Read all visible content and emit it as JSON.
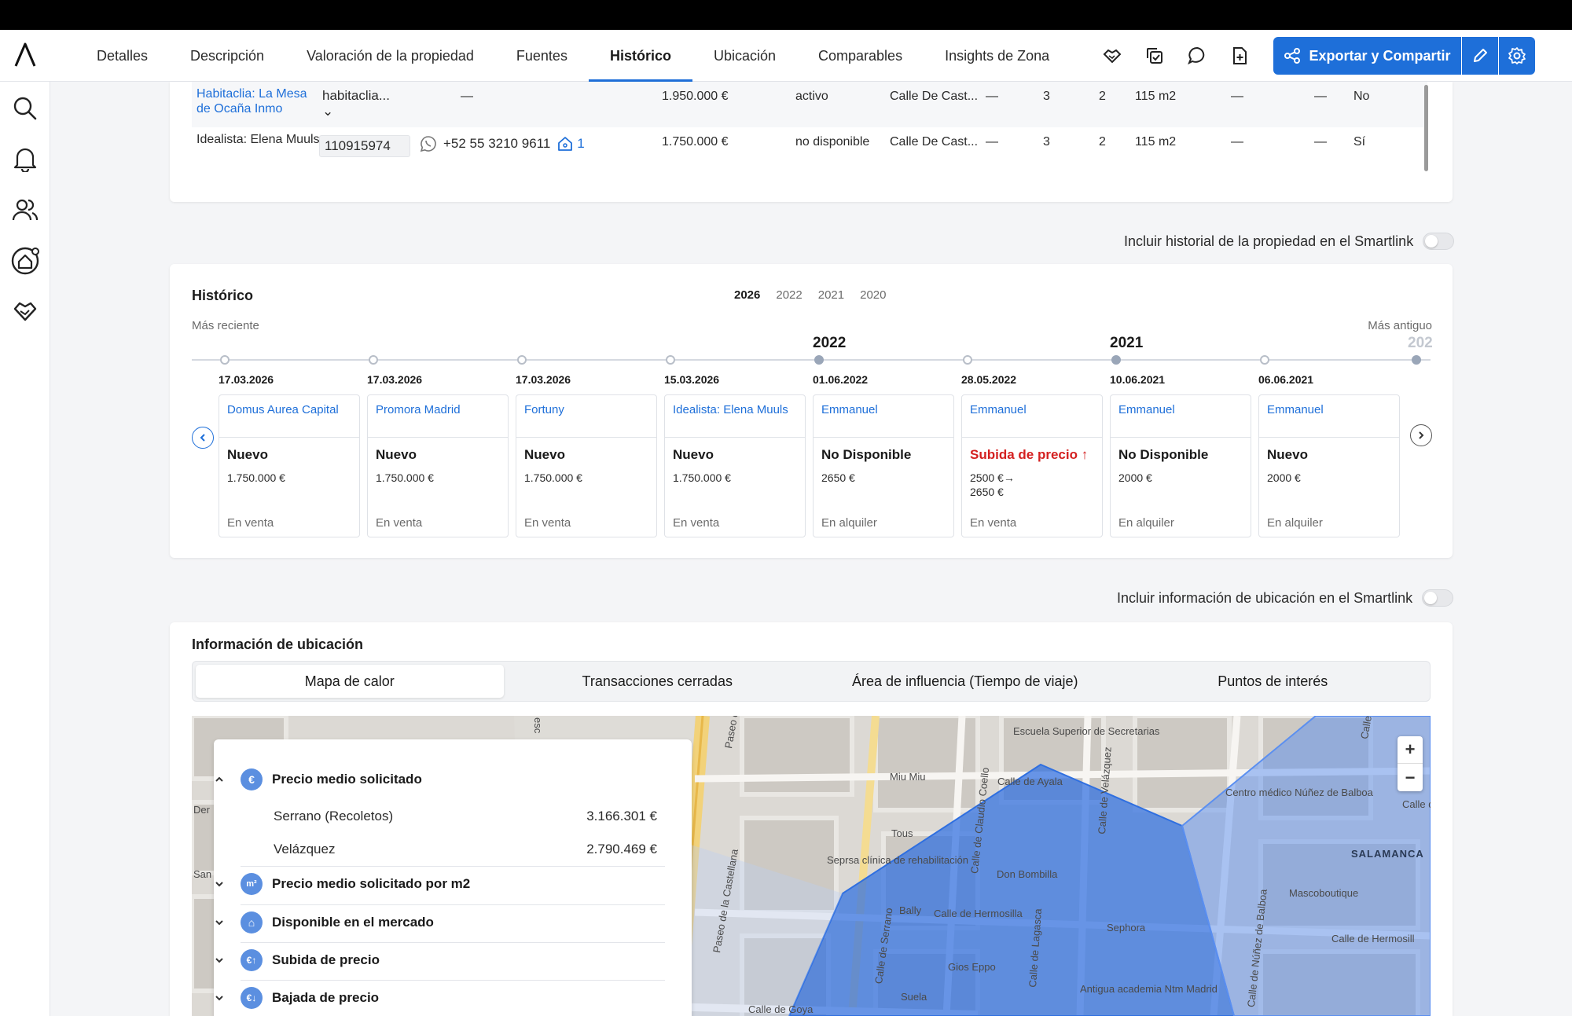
{
  "nav": {
    "tabs": [
      {
        "label": "Detalles"
      },
      {
        "label": "Descripción"
      },
      {
        "label": "Valoración de la propiedad"
      },
      {
        "label": "Fuentes"
      },
      {
        "label": "Histórico",
        "active": true
      },
      {
        "label": "Ubicación"
      },
      {
        "label": "Comparables"
      },
      {
        "label": "Insights de Zona"
      }
    ],
    "export_label": "Exportar y Compartir",
    "icons": [
      "handshake-icon",
      "copy-check-icon",
      "chat-icon",
      "file-add-icon"
    ],
    "accent": "#1e6fd9"
  },
  "sidebar": {
    "icons": [
      "search-icon",
      "bell-icon",
      "users-icon",
      "home-target-icon",
      "handshake-icon"
    ]
  },
  "sources": {
    "rows": [
      {
        "name": "Habitaclia: La Mesa de Ocaña Inmo",
        "id": "habitaclia...",
        "contact": "—",
        "price": "1.950.000 €",
        "status": "activo",
        "address": "Calle De Cast...",
        "c1": "—",
        "rooms": "3",
        "baths": "2",
        "area": "115 m2",
        "c2": "—",
        "c3": "—",
        "flag": "No"
      },
      {
        "name": "Idealista: Elena Muuls",
        "id": "110915974",
        "phone": "+52 55 3210 9611",
        "home_count": "1",
        "price": "1.750.000 €",
        "status": "no disponible",
        "address": "Calle De Cast...",
        "c1": "—",
        "rooms": "3",
        "baths": "2",
        "area": "115 m2",
        "c2": "—",
        "c3": "—",
        "flag": "Sí"
      }
    ]
  },
  "toggle_history": "Incluir historial de la propiedad en el Smartlink",
  "toggle_location": "Incluir información de ubicación en el Smartlink",
  "historico": {
    "title": "Histórico",
    "years": [
      "2026",
      "2022",
      "2021",
      "2020"
    ],
    "active_year": "2026",
    "recent_label": "Más reciente",
    "old_label": "Más antiguo",
    "year_markers": [
      "2022",
      "2021",
      "202"
    ],
    "events": [
      {
        "date": "17.03.2026",
        "source": "Domus Aurea Capital",
        "status": "Nuevo",
        "price": "1.750.000 €",
        "mode": "En venta"
      },
      {
        "date": "17.03.2026",
        "source": "Promora Madrid",
        "status": "Nuevo",
        "price": "1.750.000 €",
        "mode": "En venta"
      },
      {
        "date": "17.03.2026",
        "source": "Fortuny",
        "status": "Nuevo",
        "price": "1.750.000 €",
        "mode": "En venta"
      },
      {
        "date": "15.03.2026",
        "source": "Idealista: Elena Muuls",
        "status": "Nuevo",
        "price": "1.750.000 €",
        "mode": "En venta"
      },
      {
        "date": "01.06.2022",
        "source": "Emmanuel",
        "status": "No Disponible",
        "price": "2650 €",
        "mode": "En alquiler"
      },
      {
        "date": "28.05.2022",
        "source": "Emmanuel",
        "status": "Subida de precio ↑",
        "price": "2500 €→",
        "price2": "2650 €",
        "mode": "En venta"
      },
      {
        "date": "10.06.2021",
        "source": "Emmanuel",
        "status": "No Disponible",
        "price": "2000 €",
        "mode": "En alquiler"
      },
      {
        "date": "06.06.2021",
        "source": "Emmanuel",
        "status": "Nuevo",
        "price": "2000 €",
        "mode": "En alquiler"
      }
    ]
  },
  "ubicacion": {
    "title": "Información de ubicación",
    "tabs": [
      "Mapa de calor",
      "Transacciones cerradas",
      "Área de influencia (Tiempo de viaje)",
      "Puntos de interés"
    ],
    "stats": {
      "precio_medio": "Precio medio solicitado",
      "rows": [
        {
          "label": "Serrano (Recoletos)",
          "value": "3.166.301 €"
        },
        {
          "label": "Velázquez",
          "value": "2.790.469 €"
        }
      ],
      "sections": [
        "Precio medio solicitado por m2",
        "Disponible en el mercado",
        "Subida de precio",
        "Bajada de precio"
      ]
    },
    "map_labels": {
      "escuela": "Escuela Superior de Secretarias",
      "miu": "Miu Miu",
      "tous": "Tous",
      "seprsa": "Seprsa clínica de rehabilitación",
      "ayala": "Calle de Ayala",
      "claudio": "Calle de Claudio Coello",
      "velazquez": "Calle de Velázquez",
      "centro": "Centro médico Núñez de Balboa",
      "salamanca": "SALAMANCA",
      "bombilla": "Don Bombilla",
      "hermosilla": "Calle de Hermosilla",
      "hermosilla2": "Calle de Hermosill",
      "sephora": "Sephora",
      "masco": "Mascoboutique",
      "bally": "Bally",
      "gios": "Gios Eppo",
      "suela": "Suela",
      "academia": "Antigua academia Ntm Madrid",
      "castellana": "Paseo de la Castellana",
      "castellana2": "Paseo de la",
      "serrano": "Calle de Serrano",
      "lagasca": "Calle de Lagasca",
      "nunez": "Calle de Núñez de Balboa",
      "goya": "Calle de Goya",
      "der": "Der",
      "san": "San",
      "esc": "esc",
      "calle_right": "Calle",
      "calle_d": "Calle d"
    }
  }
}
